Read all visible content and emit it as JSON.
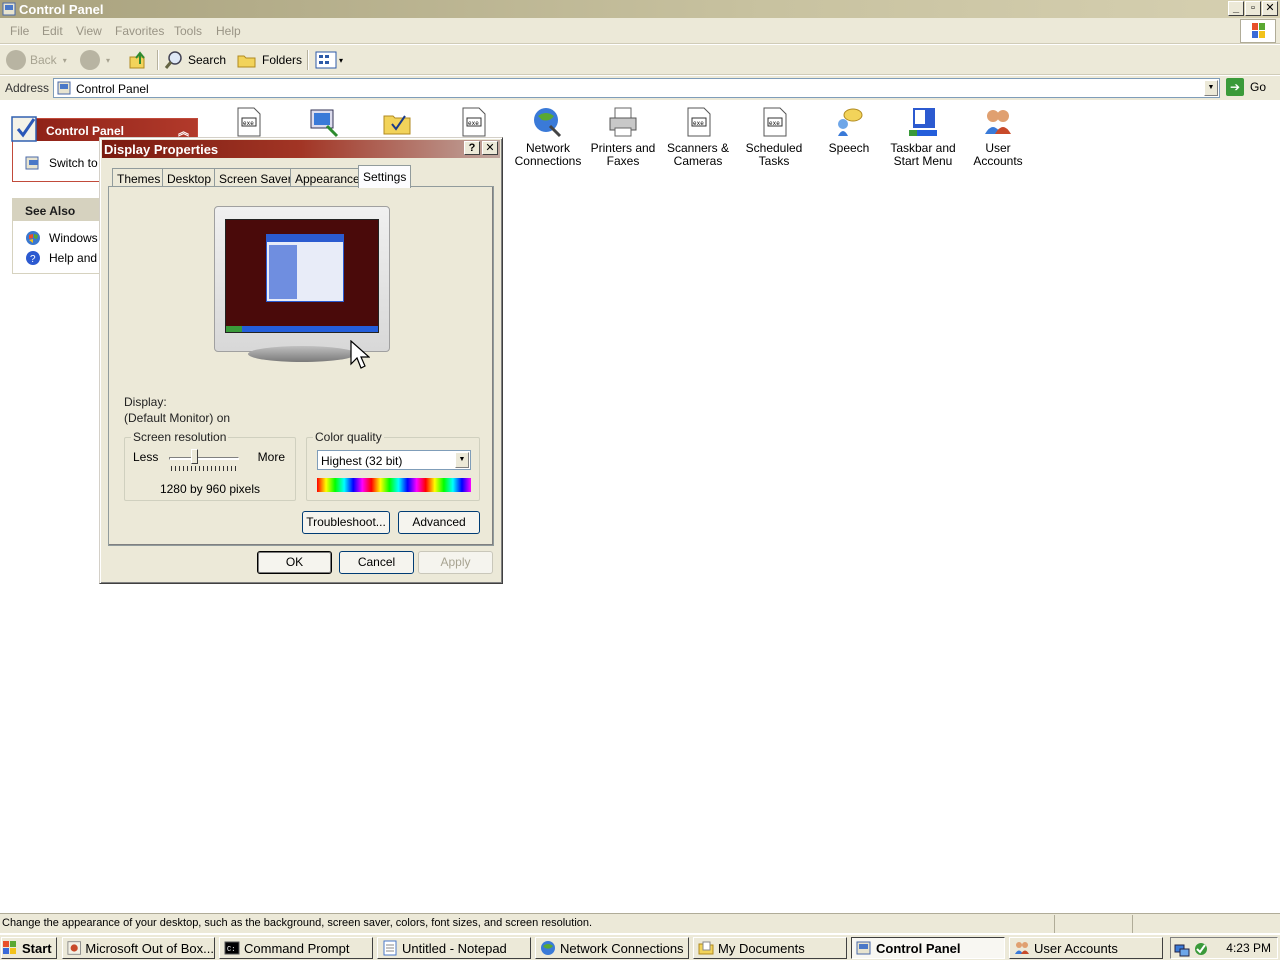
{
  "window": {
    "title": "Control Panel"
  },
  "menu": [
    "File",
    "Edit",
    "View",
    "Favorites",
    "Tools",
    "Help"
  ],
  "toolbar": {
    "back": "Back",
    "search": "Search",
    "folders": "Folders"
  },
  "address": {
    "label": "Address",
    "value": "Control Panel",
    "go": "Go"
  },
  "left_panel": {
    "control_panel": {
      "title": "Control Panel",
      "switch_label": "Switch to C"
    },
    "see_also": {
      "title": "See Also",
      "items": [
        "Windows U",
        "Help and S"
      ]
    }
  },
  "icons": [
    {
      "label": ""
    },
    {
      "label": ""
    },
    {
      "label": ""
    },
    {
      "label": ""
    },
    {
      "label": "Network Connections"
    },
    {
      "label": "Printers and Faxes"
    },
    {
      "label": "Scanners & Cameras"
    },
    {
      "label": "Scheduled Tasks"
    },
    {
      "label": "Speech"
    },
    {
      "label": "Taskbar and Start Menu"
    },
    {
      "label": "User Accounts"
    }
  ],
  "dialog": {
    "title": "Display Properties",
    "help": "?",
    "close": "✕",
    "tabs": [
      "Themes",
      "Desktop",
      "Screen Saver",
      "Appearance",
      "Settings"
    ],
    "active_tab": "Settings",
    "display_label": "Display:",
    "display_value": "(Default Monitor) on",
    "resolution": {
      "title": "Screen resolution",
      "less": "Less",
      "more": "More",
      "value": "1280 by 960 pixels",
      "slider_fraction": 0.35
    },
    "color_quality": {
      "title": "Color quality",
      "value": "Highest (32 bit)"
    },
    "buttons": {
      "troubleshoot": "Troubleshoot...",
      "advanced": "Advanced",
      "ok": "OK",
      "cancel": "Cancel",
      "apply": "Apply"
    }
  },
  "status": {
    "text": "Change the appearance of your desktop, such as the background, screen saver, colors, font sizes, and screen resolution."
  },
  "taskbar": {
    "start": "Start",
    "tasks": [
      "Microsoft Out of Box...",
      "Command Prompt",
      "Untitled - Notepad",
      "Network Connections",
      "My Documents",
      "Control Panel",
      "User Accounts"
    ],
    "active_task": "Control Panel",
    "clock": "4:23 PM"
  },
  "colors": {
    "dialog_title": "#a23525",
    "xp_blue": "#245edb",
    "desktop_preview": "#4a0a0a"
  }
}
